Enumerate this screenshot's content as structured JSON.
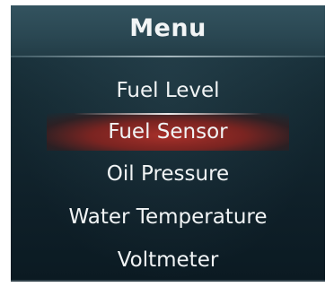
{
  "menu": {
    "title": "Menu",
    "items": [
      {
        "label": "Fuel Level",
        "selected": false
      },
      {
        "label": "Fuel Sensor",
        "selected": true
      },
      {
        "label": "Oil Pressure",
        "selected": false
      },
      {
        "label": "Water Temperature",
        "selected": false
      },
      {
        "label": "Voltmeter",
        "selected": false
      }
    ]
  },
  "colors": {
    "background": "#152a33",
    "header": "#2a4752",
    "highlight": "#a8302a",
    "text": "#f1f4f5"
  }
}
